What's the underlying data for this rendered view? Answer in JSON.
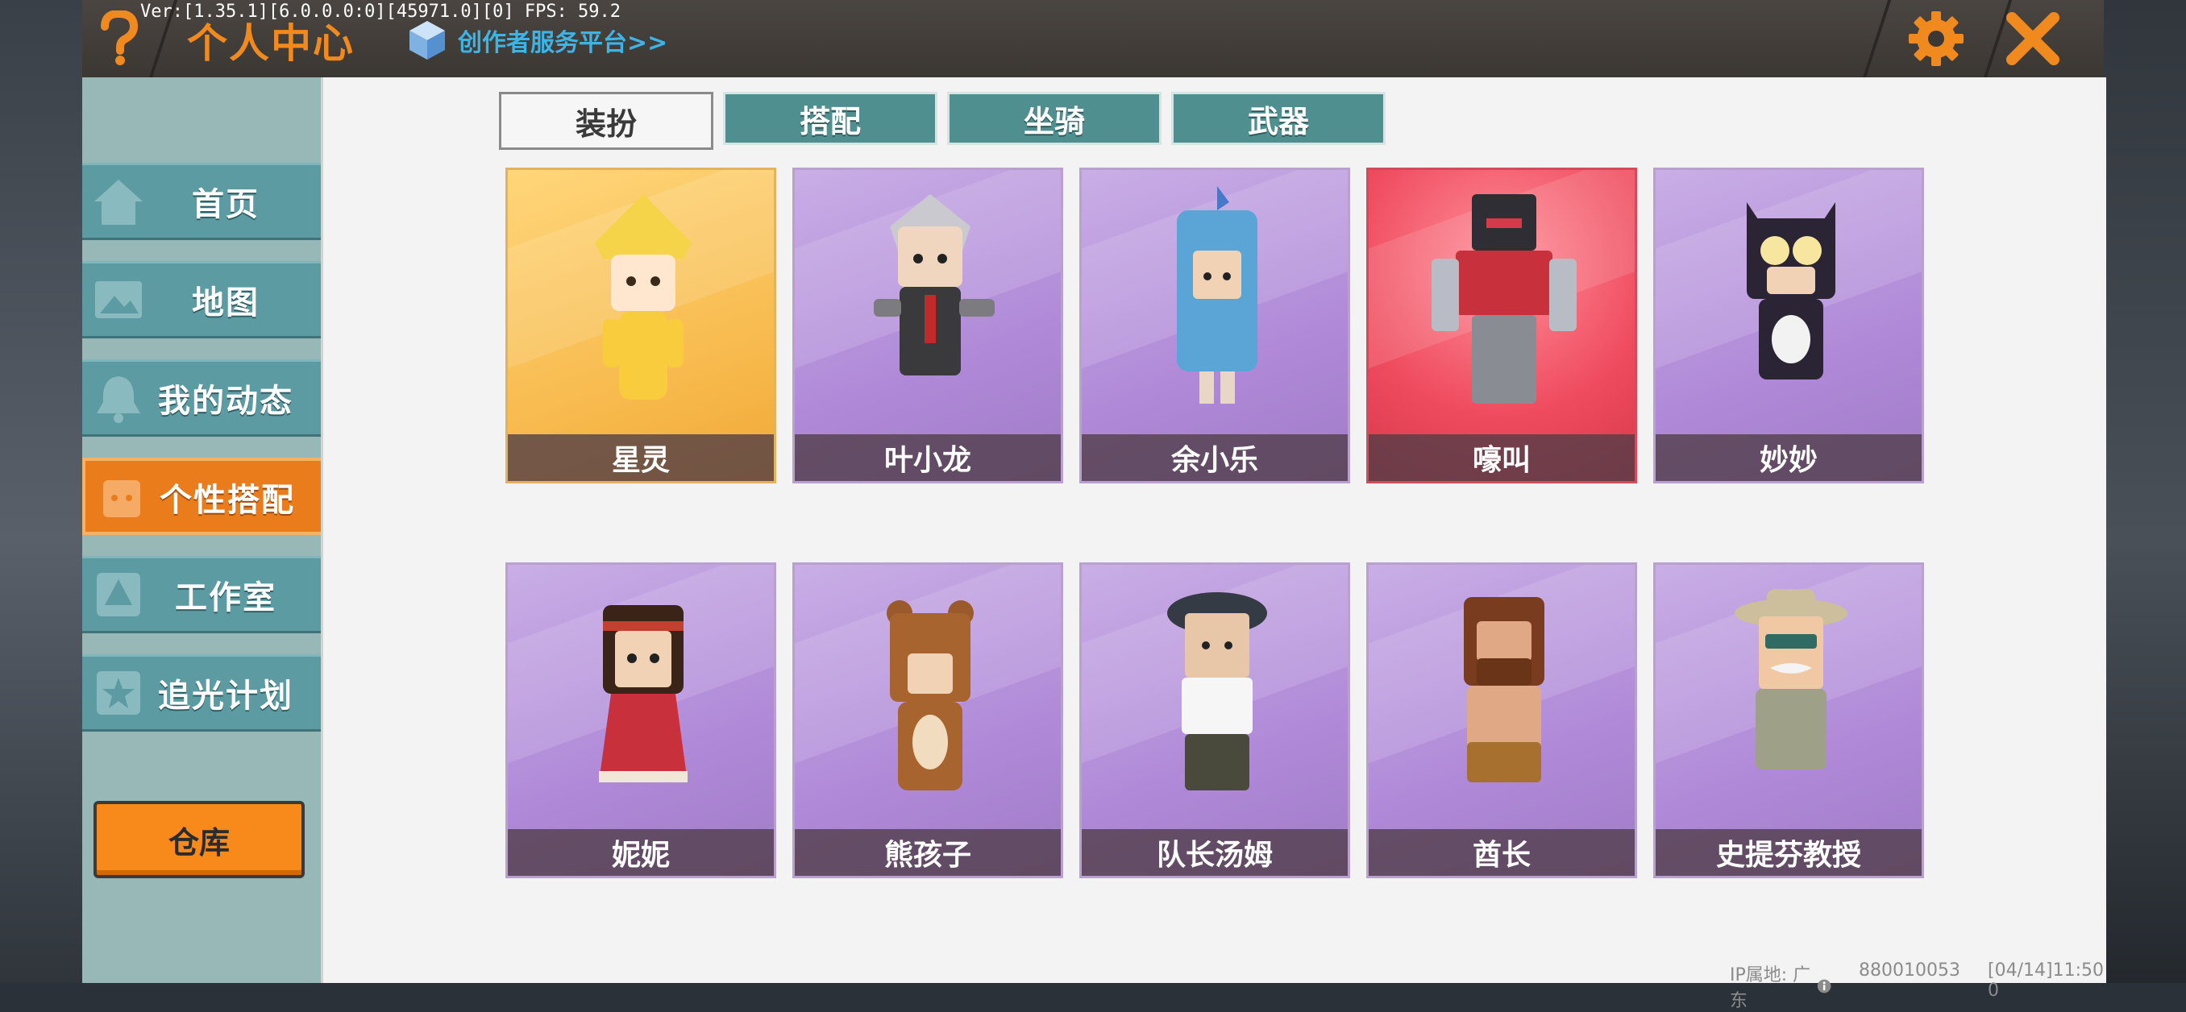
{
  "app": {
    "title": "个人中心",
    "version_text": "Ver:[1.35.1][6.0.0.0:0][45971.0][0] FPS: 59.2",
    "creator_link": "创作者服务平台>>"
  },
  "sidebar": {
    "items": [
      {
        "label": "首页",
        "icon": "home-icon",
        "active": false
      },
      {
        "label": "地图",
        "icon": "map-icon",
        "active": false
      },
      {
        "label": "我的动态",
        "icon": "bell-icon",
        "active": false
      },
      {
        "label": "个性搭配",
        "icon": "avatar-icon",
        "active": true
      },
      {
        "label": "工作室",
        "icon": "tree-icon",
        "active": false
      },
      {
        "label": "追光计划",
        "icon": "star-icon",
        "active": false
      }
    ],
    "warehouse_label": "仓库"
  },
  "tabs": [
    {
      "label": "装扮",
      "active": true
    },
    {
      "label": "搭配",
      "active": false
    },
    {
      "label": "坐骑",
      "active": false
    },
    {
      "label": "武器",
      "active": false
    }
  ],
  "characters": [
    {
      "name": "星灵",
      "theme": "gold"
    },
    {
      "name": "叶小龙",
      "theme": "purple"
    },
    {
      "name": "余小乐",
      "theme": "purple"
    },
    {
      "name": "嚎叫",
      "theme": "red"
    },
    {
      "name": "妙妙",
      "theme": "purple"
    },
    {
      "name": "妮妮",
      "theme": "purple"
    },
    {
      "name": "熊孩子",
      "theme": "purple"
    },
    {
      "name": "队长汤姆",
      "theme": "purple"
    },
    {
      "name": "酋长",
      "theme": "purple"
    },
    {
      "name": "史提芬教授",
      "theme": "purple"
    }
  ],
  "footer": {
    "ip_location": "IP属地: 广东",
    "uid": "880010053",
    "timestamp": "[04/14]11:50 0"
  },
  "colors": {
    "accent_orange": "#f08a1e",
    "teal": "#5d9ba3",
    "card_purple": "#b08ad8"
  }
}
